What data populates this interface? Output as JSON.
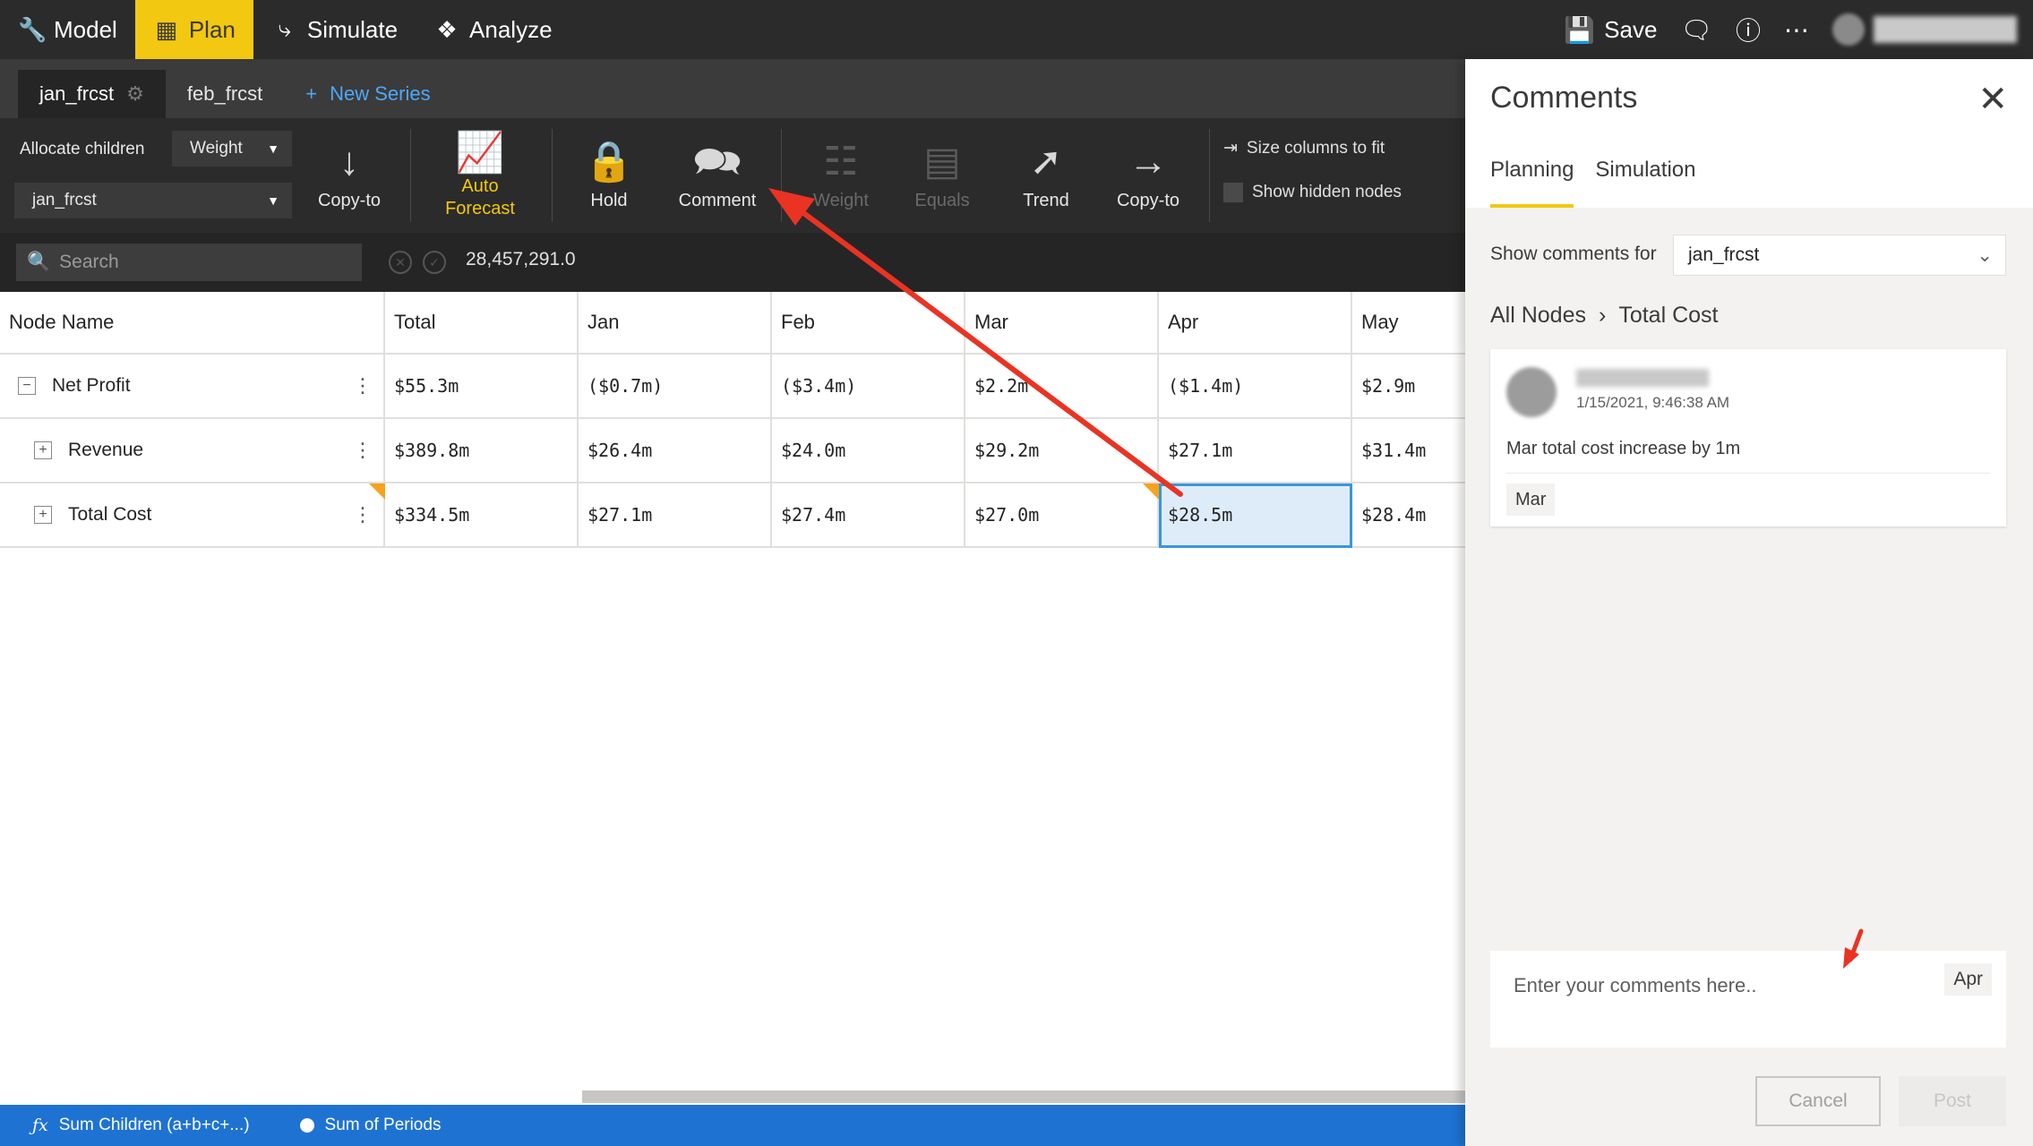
{
  "nav": {
    "items": [
      {
        "label": "Model",
        "icon": "wrench-icon"
      },
      {
        "label": "Plan",
        "icon": "grid-icon",
        "active": true
      },
      {
        "label": "Simulate",
        "icon": "branch-icon"
      },
      {
        "label": "Analyze",
        "icon": "telescope-icon"
      }
    ],
    "save_label": "Save"
  },
  "series_tabs": {
    "tabs": [
      "jan_frcst",
      "feb_frcst"
    ],
    "new_series": "New Series"
  },
  "ribbon": {
    "allocate_children": "Allocate children",
    "allocate_method": "Weight",
    "series_select": "jan_frcst",
    "copy_to_1": "Copy-to",
    "auto_forecast_1": "Auto",
    "auto_forecast_2": "Forecast",
    "hold": "Hold",
    "comment": "Comment",
    "weight": "Weight",
    "equals": "Equals",
    "trend": "Trend",
    "copy_to_2": "Copy-to",
    "size_columns": "Size columns to fit",
    "show_hidden": "Show hidden nodes"
  },
  "searchbar": {
    "placeholder": "Search",
    "value": "28,457,291.0"
  },
  "grid": {
    "columns": [
      "Node Name",
      "Total",
      "Jan",
      "Feb",
      "Mar",
      "Apr",
      "May"
    ],
    "rows": [
      {
        "name": "Net Profit",
        "toggle": "−",
        "values": [
          "$55.3m",
          "($0.7m)",
          "($3.4m)",
          "$2.2m",
          "($1.4m)",
          "$2.9m"
        ]
      },
      {
        "name": "Revenue",
        "toggle": "+",
        "values": [
          "$389.8m",
          "$26.4m",
          "$24.0m",
          "$29.2m",
          "$27.1m",
          "$31.4m"
        ]
      },
      {
        "name": "Total Cost",
        "toggle": "+",
        "values": [
          "$334.5m",
          "$27.1m",
          "$27.4m",
          "$27.0m",
          "$28.5m",
          "$28.4m"
        ]
      }
    ],
    "selected_cell": "Total Cost / Apr"
  },
  "status": {
    "formula": "Sum Children (a+b+c+...)",
    "periods": "Sum of Periods"
  },
  "comments_panel": {
    "title": "Comments",
    "tabs": [
      "Planning",
      "Simulation"
    ],
    "show_for_label": "Show comments for",
    "show_for_value": "jan_frcst",
    "breadcrumb_root": "All Nodes",
    "breadcrumb_current": "Total Cost",
    "comment": {
      "date": "1/15/2021, 9:46:38 AM",
      "text": "Mar total cost increase by 1m",
      "tag": "Mar"
    },
    "input_placeholder": "Enter your comments here..",
    "input_tag": "Apr",
    "cancel_label": "Cancel",
    "post_label": "Post"
  },
  "colors": {
    "accent": "#f2c811",
    "status_bar": "#1e73d2",
    "annotation_arrow": "#ea3323",
    "selection": "#3a96dd"
  }
}
